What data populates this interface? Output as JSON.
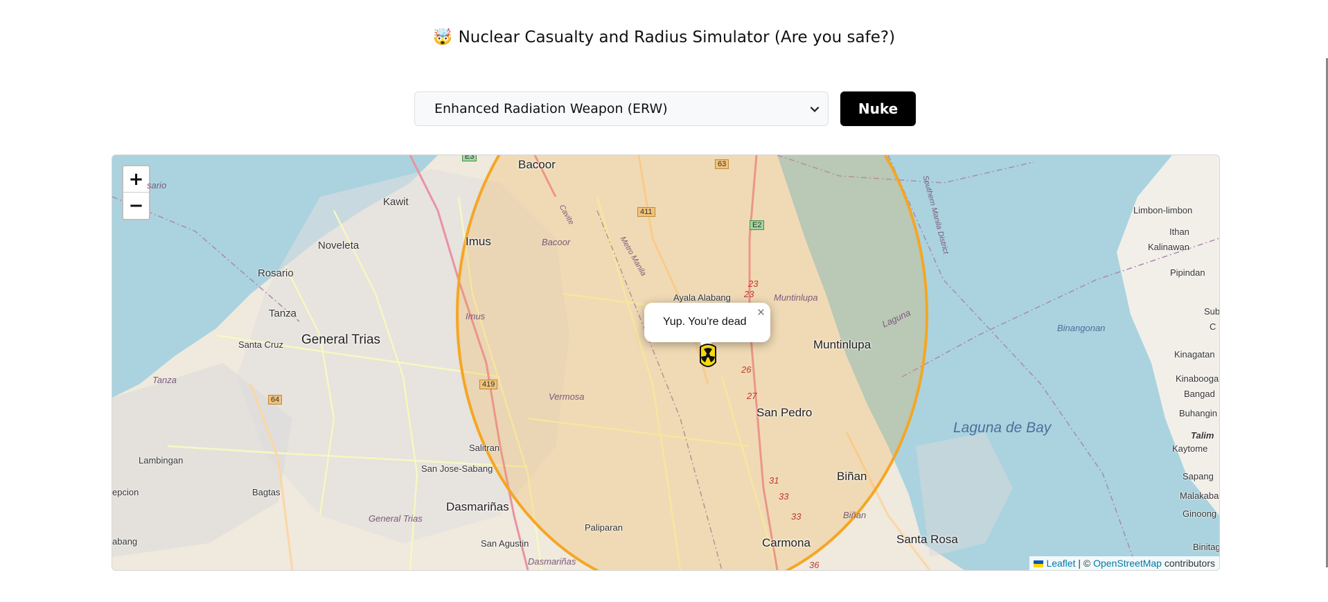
{
  "header": {
    "emoji": "🤯",
    "title": "Nuclear Casualty and Radius Simulator (Are you safe?)"
  },
  "controls": {
    "weapon_select": "Enhanced Radiation Weapon (ERW)",
    "nuke_label": "Nuke"
  },
  "map": {
    "zoom_in": "+",
    "zoom_out": "−",
    "popup_text": "Yup. You're dead",
    "popup_close": "×",
    "attribution_leaflet": "Leaflet",
    "attribution_sep": " | © ",
    "attribution_osm": "OpenStreetMap",
    "attribution_tail": " contributors",
    "blast_color": "#f5a623",
    "places": {
      "bacoor": "Bacoor",
      "kawit": "Kawit",
      "noveleta": "Noveleta",
      "imus": "Imus",
      "rosario": "Rosario",
      "sario": "sario",
      "tanza": "Tanza",
      "tanza_it": "Tanza",
      "santa_cruz": "Santa Cruz",
      "general_trias": "General Trias",
      "general_trias_it": "General Trias",
      "lambingan": "Lambingan",
      "bagtas": "Bagtas",
      "epcion": "epcion",
      "abang": "abang",
      "salitran": "Salitran",
      "san_jose_sabang": "San Jose-Sabang",
      "dasmarinas": "Dasmariñas",
      "dasmarinas_it": "Dasmariñas",
      "san_agustin": "San Agustin",
      "paliparan": "Paliparan",
      "vermosa": "Vermosa",
      "bacoor_it": "Bacoor",
      "imus_it": "Imus",
      "ayala_alabang": "Ayala Alabang",
      "muntinlupa": "Muntinlupa",
      "muntinlupa_it": "Muntinlupa",
      "san_pedro": "San Pedro",
      "binan": "Biñan",
      "binan_it": "Biñan",
      "carmona": "Carmona",
      "santa_rosa": "Santa Rosa",
      "laguna_de_bay": "Laguna de Bay",
      "laguna": "Laguna",
      "binangonan": "Binangonan",
      "southern_manila": "Southern Manila District",
      "metro_manila": "Metro Manila",
      "cavite": "Cavite",
      "limbon": "Limbon-limbon",
      "ithan": "Ithan",
      "kalinawan": "Kalinawan",
      "pipindan": "Pipindan",
      "sub": "Sub",
      "c": "C",
      "kinagatan": "Kinagatan",
      "kinabooga": "Kinabooga",
      "bangad": "Bangad",
      "buhangin": "Buhangin",
      "talim": "Talim",
      "kaytome": "Kaytome",
      "sapang": "Sapang",
      "malakaba": "Malakaba",
      "ginoong": "Ginoong",
      "binitag": "Binitag"
    },
    "shields": {
      "e3": "E3",
      "r63": "63",
      "r411": "411",
      "e2": "E2",
      "r419": "419",
      "r64": "64",
      "r23a": "23",
      "r23b": "23",
      "r26": "26",
      "r27": "27",
      "r31": "31",
      "r33a": "33",
      "r33b": "33",
      "r36": "36"
    }
  }
}
